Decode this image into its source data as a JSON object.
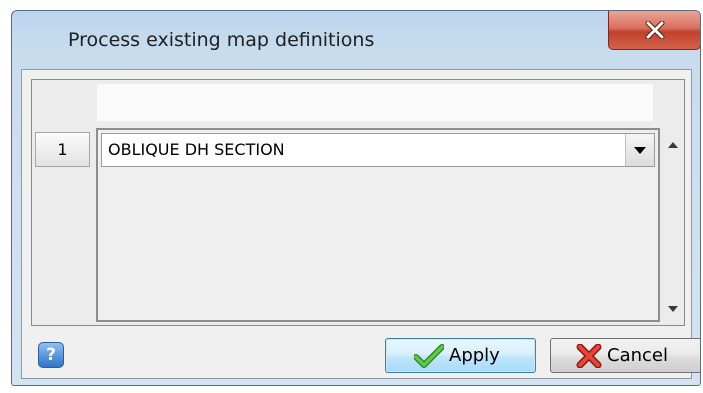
{
  "window": {
    "title": "Process existing map definitions",
    "close_icon": "close-x-icon"
  },
  "grid": {
    "rows": [
      {
        "number": "1",
        "value": "OBLIQUE DH SECTION"
      }
    ],
    "dropdown_icon": "chevron-down-icon",
    "scroll_up_icon": "scroll-up-arrow-icon",
    "scroll_down_icon": "scroll-down-arrow-icon"
  },
  "footer": {
    "help_icon": "help-question-icon",
    "help_label": "?",
    "apply_label": "Apply",
    "apply_icon": "checkmark-icon",
    "cancel_label": "Cancel",
    "cancel_icon": "red-x-icon"
  },
  "colors": {
    "title_bar": "#c9dcee",
    "close_button": "#c1412c",
    "apply_border": "#3c7fb1",
    "checkmark": "#3aa52e",
    "cancel_x": "#d5322a"
  }
}
